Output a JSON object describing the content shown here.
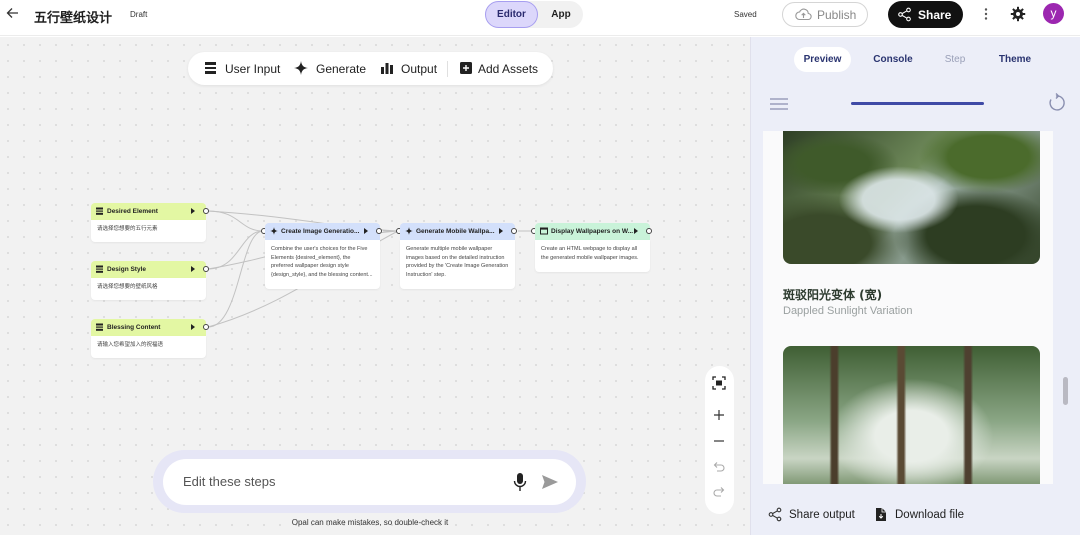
{
  "header": {
    "title": "五行壁纸设计",
    "status": "Draft",
    "mode_tabs": [
      "Editor",
      "App"
    ],
    "saved_label": "Saved",
    "publish_label": "Publish",
    "share_label": "Share",
    "avatar_initial": "y"
  },
  "toolbar": {
    "items": [
      "User Input",
      "Generate",
      "Output",
      "Add Assets"
    ]
  },
  "nodes": {
    "desired_element": {
      "title": "Desired Element",
      "body": "请选择您想要的五行元素"
    },
    "design_style": {
      "title": "Design Style",
      "body": "请选择您想要的壁纸风格"
    },
    "blessing_content": {
      "title": "Blessing Content",
      "body": "请输入您希望加入的祝福语"
    },
    "create_instruction": {
      "title": "Create Image Generatio...",
      "body": "Combine the user's choices for the Five Elements {desired_element}, the preferred wallpaper design style {design_style}, and the blessing content..."
    },
    "generate_wallpapers": {
      "title": "Generate Mobile Wallpa...",
      "body": "Generate multiple mobile wallpaper images based on the detailed instruction provided by the 'Create Image Generation Instruction' step."
    },
    "display_wallpapers": {
      "title": "Display Wallpapers on W...",
      "body": "Create an HTML webpage to display all the generated mobile wallpaper images."
    }
  },
  "chat": {
    "placeholder": "Edit these steps",
    "disclaimer": "Opal can make mistakes, so double-check it"
  },
  "panel": {
    "tabs": [
      "Preview",
      "Console",
      "Step",
      "Theme"
    ],
    "active_tab": "Preview",
    "progress_fraction": 1.0,
    "card_title": "斑驳阳光变体 (宽)",
    "card_subtitle": "Dappled Sunlight Variation",
    "footer": {
      "share_output": "Share output",
      "download_file": "Download file"
    }
  },
  "colors": {
    "accent": "#a79ef0",
    "user_input_node": "#e3f7a3",
    "generate_node": "#d3e0fb",
    "output_node": "#c9f3d9",
    "avatar": "#9c27b0"
  }
}
